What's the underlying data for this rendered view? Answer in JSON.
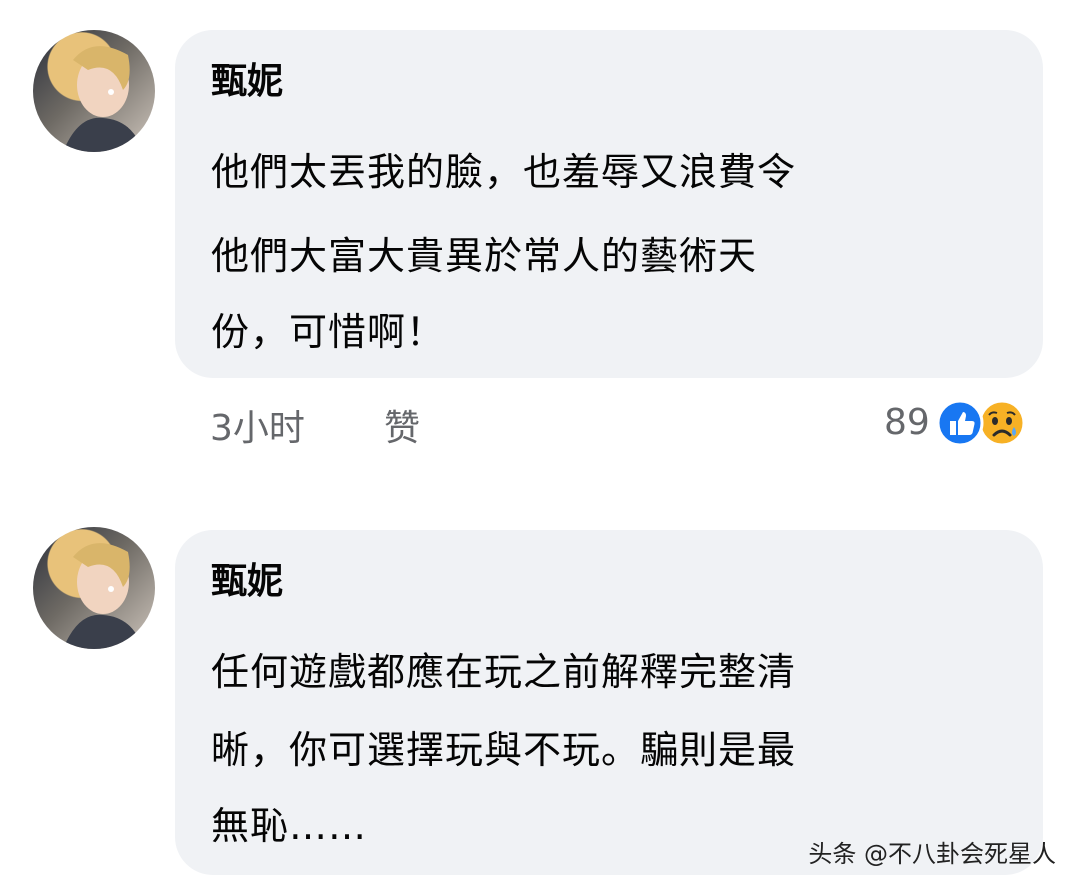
{
  "comments": [
    {
      "author": "甄妮",
      "lines": [
        "他們太丟我的臉，也羞辱又浪費令",
        "他們大富大貴異於常人的藝術天",
        "份，可惜啊！"
      ],
      "time": "3小时",
      "like_label": "赞",
      "reaction_count": "89",
      "reaction_icons": [
        "like-icon",
        "sad-icon"
      ]
    },
    {
      "author": "甄妮",
      "lines": [
        "任何遊戲都應在玩之前解釋完整清",
        "晰，你可選擇玩與不玩。騙則是最",
        "無恥……"
      ]
    }
  ],
  "watermark": "头条 @不八卦会死星人",
  "colors": {
    "bubble": "#f0f2f5",
    "meta": "#65676b",
    "like": "#1877f2",
    "sad": "#f7b125"
  }
}
